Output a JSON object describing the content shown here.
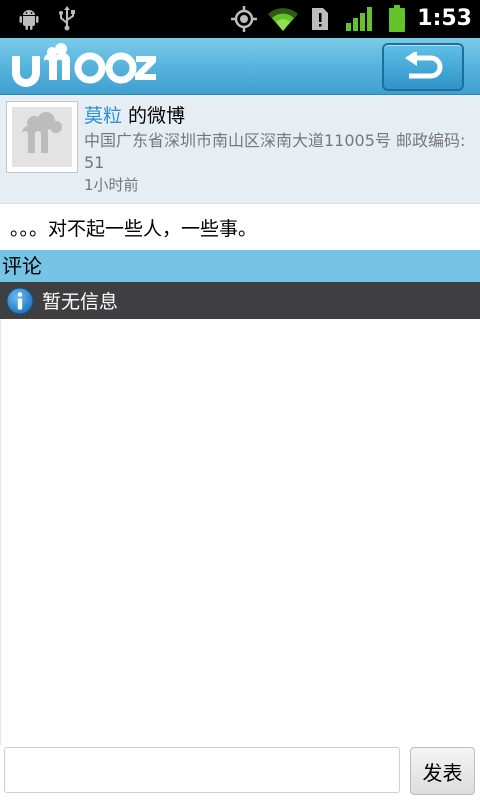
{
  "status_bar": {
    "time": "1:53",
    "icons": [
      "android-debug-icon",
      "usb-icon",
      "gps-icon",
      "wifi-icon",
      "sim-alert-icon",
      "signal-icon",
      "battery-icon"
    ]
  },
  "app": {
    "logo_text": "umooz",
    "back_icon": "back-arrow-icon",
    "accent_color": "#57b4dc"
  },
  "post": {
    "author": "莫粒",
    "title_suffix": " 的微博",
    "address": "中国广东省深圳市南山区深南大道11005号 邮政编码: 51",
    "time": "1小时前",
    "content": "。。。对不起一些人，一些事。"
  },
  "comments": {
    "label": "评论",
    "empty_message": "暂无信息"
  },
  "comment_bar": {
    "input_value": "",
    "input_placeholder": "",
    "send_label": "发表"
  }
}
